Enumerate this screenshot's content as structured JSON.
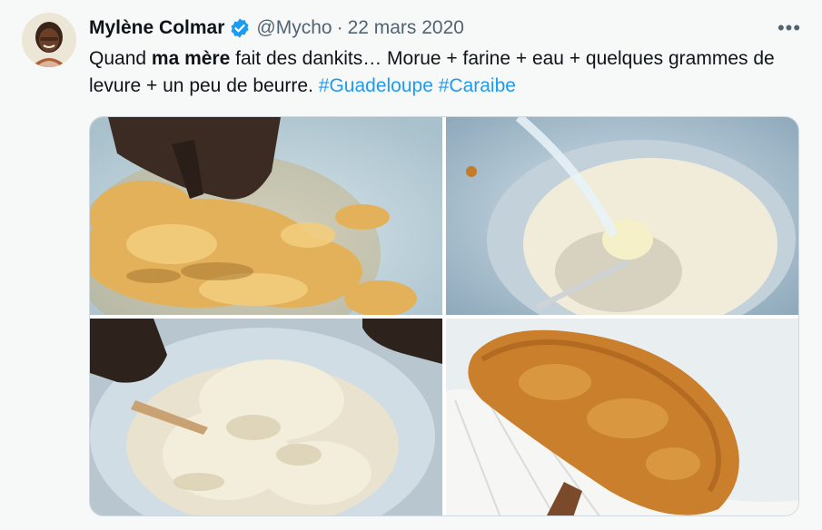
{
  "author": {
    "name": "Mylène Colmar",
    "handle": "@Mycho",
    "separator": "·",
    "date": "22 mars 2020",
    "avatar_icon": "profile-photo",
    "verified_icon": "verified-badge-icon",
    "verified_color": "#1d9bf0"
  },
  "more_icon": "more-options-icon",
  "more_glyph": "•••",
  "tweet": {
    "text_part1": "Quand ",
    "text_bold": "ma mère",
    "text_part2": " fait des dankits… Morue + farine + eau + quelques grammes de levure + un peu de beurre. ",
    "hashtag1": "#Guadeloupe",
    "hashtag_space": " ",
    "hashtag2": "#Caraibe"
  },
  "colors": {
    "hashtag": "#1d9bf0",
    "secondary_text": "#536471",
    "background": "#f7f9f9"
  },
  "media": {
    "photos": [
      "shredded-cod-in-bowl-photo",
      "flour-and-water-in-bowl-photo",
      "mixing-dough-photo",
      "fried-dankit-on-paper-towel-photo"
    ]
  }
}
